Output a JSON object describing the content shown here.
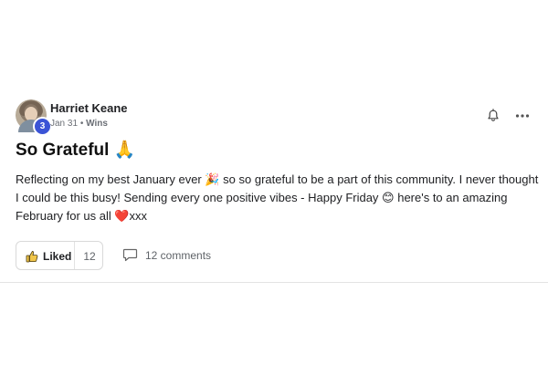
{
  "post": {
    "author": "Harriet Keane",
    "level": "3",
    "date": "Jan 31",
    "separator": "•",
    "category": "Wins",
    "title": "So Grateful 🙏",
    "body": "Reflecting on my best January ever 🎉 so so grateful to be a part of this community. I never thought I could be this busy! Sending every one positive vibes - Happy Friday 😊 here's to an amazing February for us all ❤️xxx",
    "like_label": "Liked",
    "like_count": "12",
    "comments_label": "12 comments",
    "icons": {
      "bell": "bell-icon",
      "more": "more-horizontal-icon",
      "like": "thumbs-up-icon",
      "comment": "comment-icon"
    },
    "colors": {
      "badge": "#3b54d6"
    }
  }
}
